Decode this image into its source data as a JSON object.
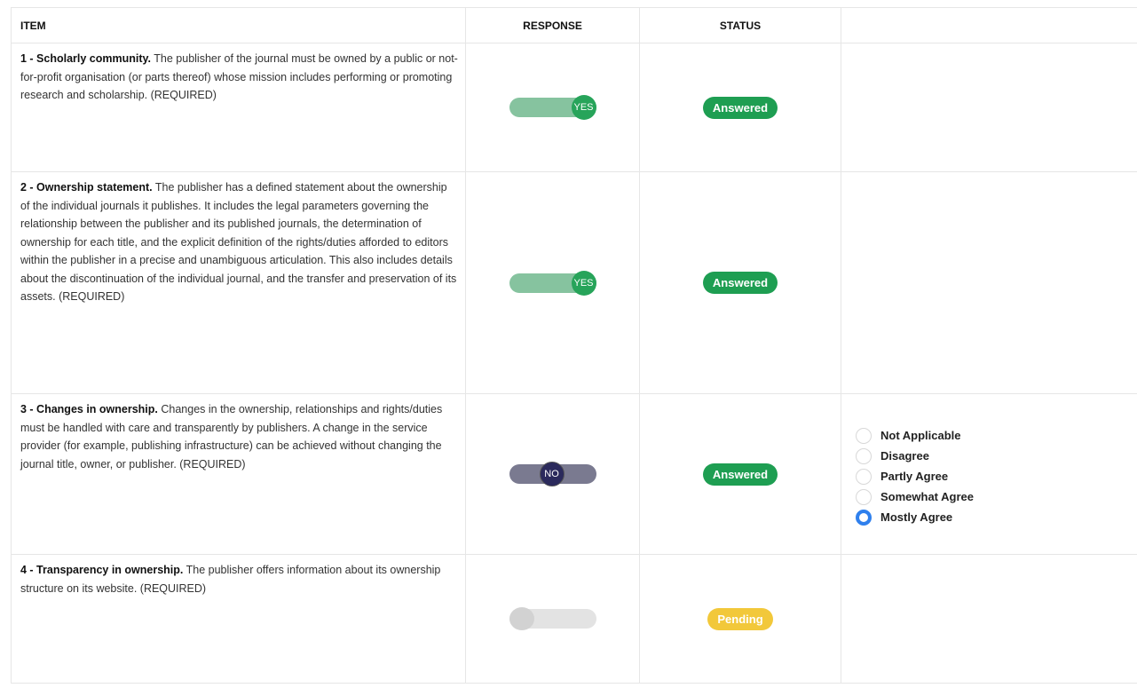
{
  "headers": {
    "item": "ITEM",
    "response": "RESPONSE",
    "status": "STATUS",
    "extra": ""
  },
  "rows": [
    {
      "title": "1 - Scholarly community.",
      "desc": " The publisher of the journal must be owned by a public or not-for-profit organisation (or parts thereof) whose mission includes performing or promoting research and scholarship. (REQUIRED)",
      "response": "YES",
      "status": "Answered"
    },
    {
      "title": "2 - Ownership statement.",
      "desc": " The publisher has a defined statement about the ownership of the individual journals it publishes. It includes the legal parameters governing the relationship between the publisher and its published journals, the determination of ownership for each title, and the explicit definition of the rights/duties afforded to editors within the publisher in a precise and unambiguous articulation. This also includes details about the discontinuation of the individual journal, and the transfer and preservation of its assets. (REQUIRED)",
      "response": "YES",
      "status": "Answered"
    },
    {
      "title": "3 - Changes in ownership.",
      "desc": " Changes in the ownership, relationships and rights/duties must be handled with care and transparently by publishers. A change in the service provider (for example, publishing infrastructure) can be achieved without changing the journal title, owner, or publisher. (REQUIRED)",
      "response": "NO",
      "status": "Answered",
      "options": [
        "Not Applicable",
        "Disagree",
        "Partly Agree",
        "Somewhat Agree",
        "Mostly Agree"
      ],
      "selected_option": "Mostly Agree"
    },
    {
      "title": "4 - Transparency in ownership.",
      "desc": " The publisher offers information about its ownership structure on its website. (REQUIRED)",
      "response": "",
      "status": "Pending"
    }
  ],
  "colors": {
    "answered": "#1e9e52",
    "pending": "#f2c83a",
    "yes_knob": "#27a45a",
    "no_knob": "#2b2a5c",
    "radio_selected": "#2f80ed"
  },
  "icons": {
    "radio": "radio-circle",
    "toggle": "toggle-switch"
  }
}
